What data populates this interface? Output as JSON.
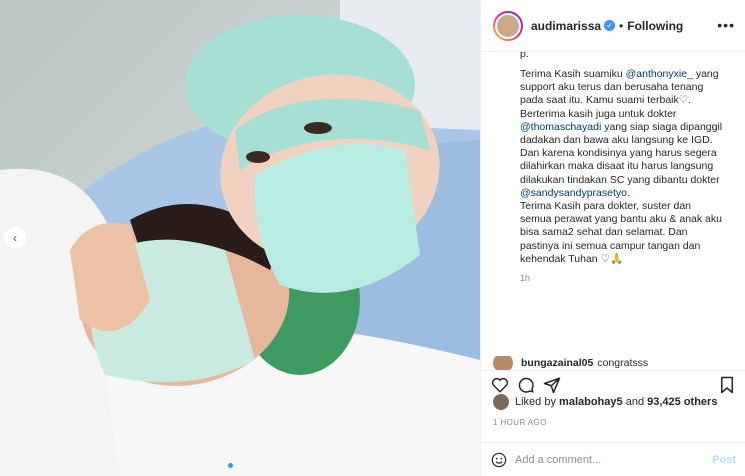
{
  "header": {
    "username": "audimarissa",
    "separator": "•",
    "follow_status": "Following",
    "more_icon": "more-horizontal-icon"
  },
  "photo": {
    "nav_prev_icon": "chevron-left-icon",
    "carousel_dots": 2,
    "active_dot": 0
  },
  "caption": {
    "top_fragment": "p.",
    "lines": [
      {
        "text": "Terima Kasih suamiku "
      },
      {
        "mention": "@anthonyxie_"
      },
      {
        "text": " yang support aku terus dan berusaha tenang pada saat itu. Kamu suami terbaik♡. Berterima kasih juga untuk dokter "
      },
      {
        "mention": "@thomaschayadi"
      },
      {
        "text": " yang siap siaga dipanggil dadakan dan bawa aku langsung ke IGD. Dan karena kondisinya yang harus segera dilahirkan maka disaat itu harus langsung dilakukan tindakan SC yang dibantu dokter "
      },
      {
        "mention": "@sandysandyprasetyo"
      },
      {
        "text": "."
      }
    ],
    "paragraph2": "Terima Kasih para dokter, suster dan semua perawat yang bantu aku & anak aku bisa sama2 sehat dan selamat. Dan pastinya ini semua campur tangan dan kehendak Tuhan ♡🙏",
    "time": "1h"
  },
  "comment": {
    "username": "bungazainal05",
    "text": "congratsss"
  },
  "actions": {
    "like_icon": "heart-icon",
    "comment_icon": "comment-icon",
    "share_icon": "send-icon",
    "save_icon": "bookmark-icon"
  },
  "likes": {
    "prefix": "Liked by ",
    "user": "malabohay5",
    "middle": " and ",
    "count": "93,425 others"
  },
  "timestamp": "1 HOUR AGO",
  "add_comment": {
    "placeholder": "Add a comment...",
    "post_label": "Post"
  },
  "colors": {
    "accent": "#3897f0",
    "mention": "#00376b",
    "muted": "#8e8e8e"
  }
}
